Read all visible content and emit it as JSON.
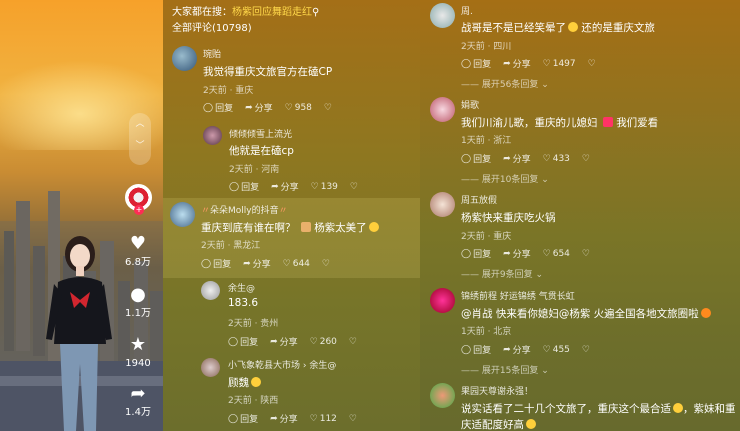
{
  "search": {
    "prefix": "大家都在搜：",
    "term": "杨紫回应舞蹈走红",
    "icon": "search-icon"
  },
  "comments_total": "全部评论(10798)",
  "rail": {
    "likes": "6.8万",
    "comments": "1.1万",
    "stars": "1940",
    "shares": "1.4万"
  },
  "mid": [
    {
      "name": "琬贻",
      "text": "我觉得重庆文旅官方在磕CP",
      "meta": "2天前 · 重庆",
      "reply": "回复",
      "share": "分享",
      "likes": "958"
    },
    {
      "name": "倾倾倾雪上流光",
      "text": "他就是在磕cp",
      "meta": "2天前 · 河南",
      "reply": "回复",
      "share": "分享",
      "likes": "139"
    },
    {
      "name": "朵朵Molly的抖音",
      "text": "重庆到底有谁在啊？",
      "text2": "杨紫太美了",
      "meta": "2天前 · 黑龙江",
      "reply": "回复",
      "share": "分享",
      "likes": "644"
    },
    {
      "name": "余生@",
      "text": "183.6",
      "meta": "2天前 · 贵州",
      "reply": "回复",
      "share": "分享",
      "likes": "260"
    },
    {
      "name": "小飞象乾县大市场 › 余生@",
      "text": "顾魏",
      "meta": "2天前 · 陕西",
      "reply": "回复",
      "share": "分享",
      "likes": "112"
    }
  ],
  "right": [
    {
      "name": "周.",
      "text": "战哥是不是已经笑晕了",
      "text2": "还的是重庆文旅",
      "meta": "2天前 · 四川",
      "reply": "回复",
      "share": "分享",
      "likes": "1497",
      "expand": "展开56条回复"
    },
    {
      "name": "娟歌",
      "text": "我们川渝儿歌，重庆的儿媳妇",
      "text2": "我们爱看",
      "meta": "1天前 · 浙江",
      "reply": "回复",
      "share": "分享",
      "likes": "433",
      "expand": "展开10条回复"
    },
    {
      "name": "周五放假",
      "text": "杨紫快来重庆吃火锅",
      "meta": "2天前 · 重庆",
      "reply": "回复",
      "share": "分享",
      "likes": "654",
      "expand": "展开9条回复"
    },
    {
      "name": "锦绣前程 好运锦绣 气贯长虹",
      "text": "@肖战 快来看你媳妇@杨紫 火遍全国各地文旅圈啦",
      "meta": "1天前 · 北京",
      "reply": "回复",
      "share": "分享",
      "likes": "455",
      "expand": "展开15条回复"
    },
    {
      "name": "果园天尊谢永强！",
      "text": "说实话看了二十几个文旅了，重庆这个最合适",
      "text2": "，紫妹和重",
      "text3": "庆适配度好高"
    }
  ],
  "colors": {
    "highlight": "#ffd84a",
    "follow": "#fe2c55"
  }
}
